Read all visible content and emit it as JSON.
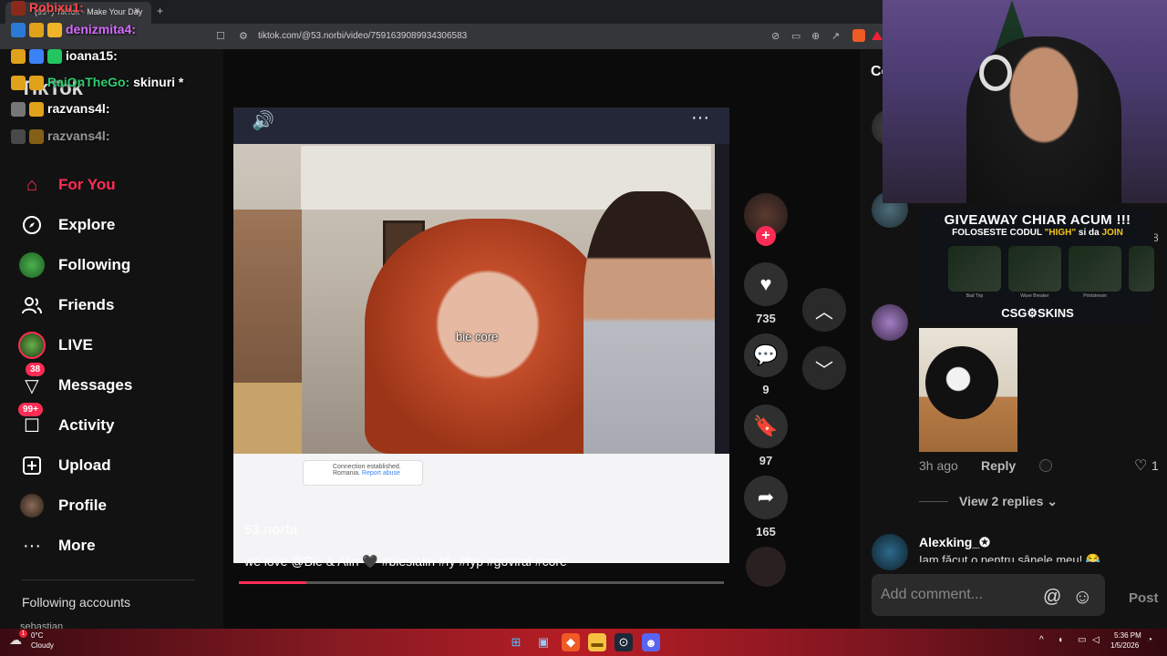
{
  "browser": {
    "tab_title": "(99+) TikTok - Make Your Day",
    "tab_close": "×",
    "new_tab": "+",
    "url": "tiktok.com/@53.norbi/video/7591639089934306583"
  },
  "chat": [
    {
      "user": "Robixu1:",
      "text": "",
      "color": "#ff4a4a"
    },
    {
      "user": "denizmita4:",
      "text": "",
      "color": "#d36bff"
    },
    {
      "user": "ioana15:",
      "text": "",
      "color": "#fff"
    },
    {
      "user": "RaiOnTheGo:",
      "text": "skinuri *",
      "color": "#2ecc71"
    },
    {
      "user": "razvans4l:",
      "text": "",
      "color": "#fff"
    },
    {
      "user": "razvans4l:",
      "text": "",
      "color": "#fff"
    }
  ],
  "nav": {
    "logo": "TikTok",
    "items": [
      {
        "label": "For You",
        "icon": "home-icon"
      },
      {
        "label": "Explore",
        "icon": "compass-icon"
      },
      {
        "label": "Following",
        "icon": "following-avatar-icon"
      },
      {
        "label": "Friends",
        "icon": "friends-icon"
      },
      {
        "label": "LIVE",
        "icon": "live-icon"
      },
      {
        "label": "Messages",
        "icon": "messages-icon",
        "badge": "38"
      },
      {
        "label": "Activity",
        "icon": "activity-icon",
        "badge": "99+"
      },
      {
        "label": "Upload",
        "icon": "upload-icon"
      },
      {
        "label": "Profile",
        "icon": "profile-icon"
      },
      {
        "label": "More",
        "icon": "more-icon"
      }
    ],
    "following_accounts": "Following accounts",
    "following_first": "sebastian"
  },
  "video": {
    "subtitle": "bie core",
    "author": "53.norbi",
    "caption": "we love @Bie & Alin 🖤 #biesialin #fy #fyp #goviral #core",
    "connection_title": "Connection established.",
    "connection_country": "Romania.",
    "connection_report": "Report abuse",
    "progress": 0.14,
    "actions": {
      "likes": "735",
      "comments": "9",
      "saves": "97",
      "shares": "165"
    }
  },
  "giveaway": {
    "title": "GIVEAWAY CHIAR ACUM !!!",
    "sub_prefix": "FOLOSESTE CODUL ",
    "code": "\"HIGH\"",
    "sub_mid": " si da ",
    "sub_join": "JOIN",
    "brand": "CSG⚙SKINS",
    "skins": [
      "Bad Trip",
      "Wave Breaker",
      "Printstream",
      ""
    ]
  },
  "comments": {
    "title": "Co",
    "partial_count": "8",
    "time": "3h ago",
    "reply": "Reply",
    "likes": "1",
    "view_replies": "View 2 replies",
    "next_user": "Alexking_✪",
    "next_text": "Iam făcut o pentru sânele meu! 😂",
    "input_placeholder": "Add comment...",
    "post": "Post"
  },
  "taskbar": {
    "temp": "0°C",
    "condition": "Cloudy",
    "weather_badge": "1",
    "time": "5:36 PM",
    "date": "1/5/2026"
  }
}
